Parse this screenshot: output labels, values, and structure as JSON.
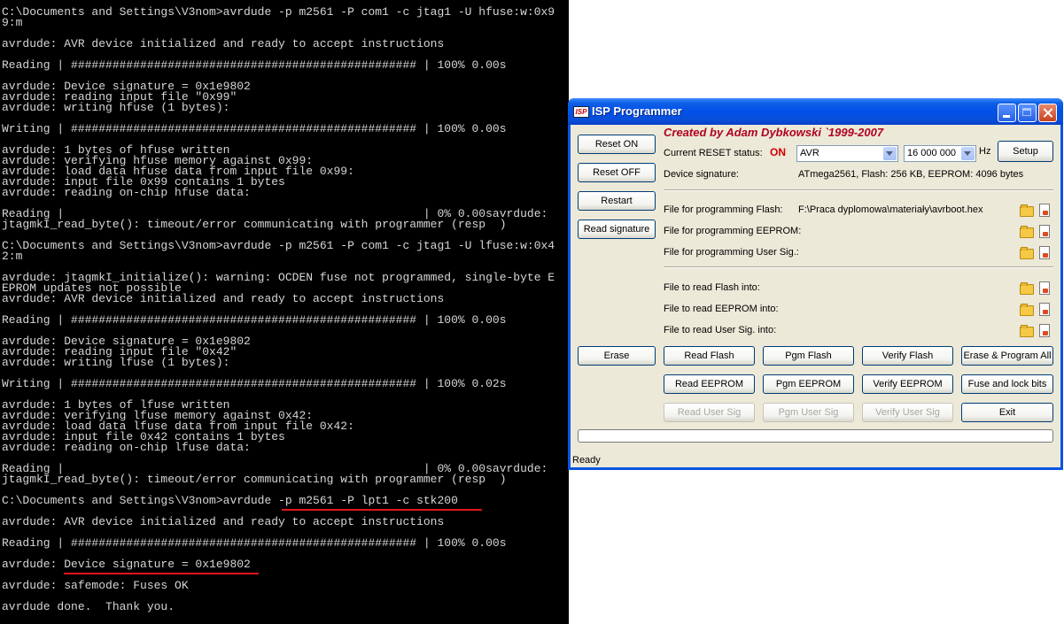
{
  "console": {
    "lines": [
      "C:\\Documents and Settings\\V3nom>avrdude -p m2561 -P com1 -c jtag1 -U hfuse:w:0x9",
      "9:m",
      "",
      "avrdude: AVR device initialized and ready to accept instructions",
      "",
      "Reading | ################################################## | 100% 0.00s",
      "",
      "avrdude: Device signature = 0x1e9802",
      "avrdude: reading input file \"0x99\"",
      "avrdude: writing hfuse (1 bytes):",
      "",
      "Writing | ################################################## | 100% 0.00s",
      "",
      "avrdude: 1 bytes of hfuse written",
      "avrdude: verifying hfuse memory against 0x99:",
      "avrdude: load data hfuse data from input file 0x99:",
      "avrdude: input file 0x99 contains 1 bytes",
      "avrdude: reading on-chip hfuse data:",
      "",
      "Reading |                                                    | 0% 0.00savrdude:",
      "jtagmkI_read_byte(): timeout/error communicating with programmer (resp  )",
      "",
      "C:\\Documents and Settings\\V3nom>avrdude -p m2561 -P com1 -c jtag1 -U lfuse:w:0x4",
      "2:m",
      "",
      "avrdude: jtagmkI_initialize(): warning: OCDEN fuse not programmed, single-byte E",
      "EPROM updates not possible",
      "avrdude: AVR device initialized and ready to accept instructions",
      "",
      "Reading | ################################################## | 100% 0.00s",
      "",
      "avrdude: Device signature = 0x1e9802",
      "avrdude: reading input file \"0x42\"",
      "avrdude: writing lfuse (1 bytes):",
      "",
      "Writing | ################################################## | 100% 0.02s",
      "",
      "avrdude: 1 bytes of lfuse written",
      "avrdude: verifying lfuse memory against 0x42:",
      "avrdude: load data lfuse data from input file 0x42:",
      "avrdude: input file 0x42 contains 1 bytes",
      "avrdude: reading on-chip lfuse data:",
      "",
      "Reading |                                                    | 0% 0.00savrdude:",
      "jtagmkI_read_byte(): timeout/error communicating with programmer (resp  )",
      "",
      "C:\\Documents and Settings\\V3nom>avrdude -p m2561 -P lpt1 -c stk200",
      "",
      "avrdude: AVR device initialized and ready to accept instructions",
      "",
      "Reading | ################################################## | 100% 0.00s",
      "",
      "avrdude: Device signature = 0x1e9802",
      "",
      "avrdude: safemode: Fuses OK",
      "",
      "avrdude done.  Thank you."
    ],
    "highlight_color": "#e0141e"
  },
  "window": {
    "title": "ISP Programmer",
    "icon_text": "ISP",
    "credit": "Created by Adam Dybkowski `1999-2007",
    "buttons": {
      "reset_on": "Reset ON",
      "reset_off": "Reset OFF",
      "restart": "Restart",
      "read_signature": "Read signature",
      "setup": "Setup",
      "erase": "Erase",
      "read_flash": "Read Flash",
      "pgm_flash": "Pgm Flash",
      "verify_flash": "Verify Flash",
      "erase_program_all": "Erase & Program All",
      "read_eeprom": "Read EEPROM",
      "pgm_eeprom": "Pgm EEPROM",
      "verify_eeprom": "Verify EEPROM",
      "fuse_lock_bits": "Fuse and lock bits",
      "read_user_sig": "Read User Sig",
      "pgm_user_sig": "Pgm User Sig",
      "verify_user_sig": "Verify User Sig",
      "exit": "Exit"
    },
    "reset_status_label": "Current RESET status:",
    "reset_status_value": "ON",
    "device_select": "AVR",
    "frequency_select": "16 000 000",
    "frequency_unit": "Hz",
    "device_signature_label": "Device signature:",
    "device_signature_value": "ATmega2561, Flash: 256 KB, EEPROM: 4096 bytes",
    "files": {
      "prog_flash_label": "File for programming Flash:",
      "prog_flash_value": "F:\\Praca dyplomowa\\materiały\\avrboot.hex",
      "prog_eeprom_label": "File for programming EEPROM:",
      "prog_usersig_label": "File for programming User Sig.:",
      "read_flash_label": "File to read Flash into:",
      "read_eeprom_label": "File to read EEPROM into:",
      "read_usersig_label": "File to read User Sig. into:"
    },
    "status_text": "Ready"
  }
}
